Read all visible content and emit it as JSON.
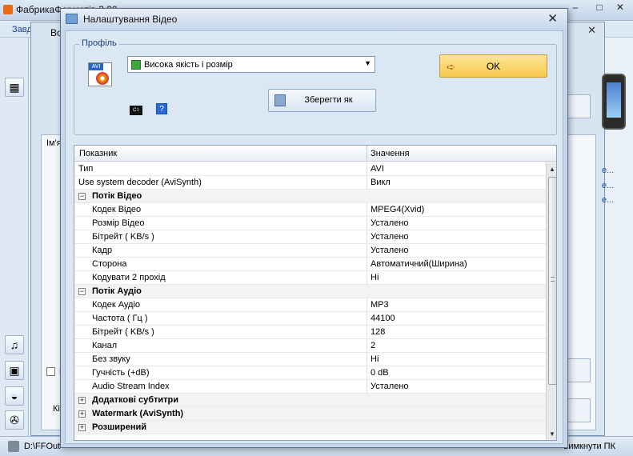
{
  "background": {
    "app_title": "ФабрикаФорматів 3.00",
    "menu_first": "Завд",
    "window2_title": "Во",
    "column_fragment": "Ім'я",
    "links": [
      "е...",
      "е...",
      "е..."
    ],
    "checkbox_fragment": "П",
    "label_fragment": "Кін",
    "status_path": "D:\\FFOut",
    "status_right": "вимкнути ПК"
  },
  "dialog": {
    "title": "Налаштування Відео",
    "profile_group_label": "Профіль",
    "profile_selected": "Висока якість і розмір",
    "ok_label": "OK",
    "save_as_label": "Зберегти як",
    "cmd_icon_text": "C:\\",
    "help_icon_text": "?"
  },
  "grid": {
    "header_name": "Показник",
    "header_value": "Значення",
    "rows": [
      {
        "name": "Тип",
        "value": "AVI"
      },
      {
        "name": "Use system decoder (AviSynth)",
        "value": "Викл"
      },
      {
        "name": "Потік Відео",
        "category": true
      },
      {
        "name": "Кодек Відео",
        "value": "MPEG4(Xvid)"
      },
      {
        "name": "Розмір Відео",
        "value": "Усталено"
      },
      {
        "name": "Бітрейт ( KB/s )",
        "value": "Усталено"
      },
      {
        "name": "Кадр",
        "value": "Усталено"
      },
      {
        "name": "Сторона",
        "value": "Автоматичний(Ширина)"
      },
      {
        "name": "Кодувати 2 прохід",
        "value": "Ні"
      },
      {
        "name": "Потік Аудіо",
        "category": true
      },
      {
        "name": "Кодек Аудіо",
        "value": "MP3"
      },
      {
        "name": "Частота ( Гц )",
        "value": "44100"
      },
      {
        "name": "Бітрейт ( KB/s )",
        "value": "128"
      },
      {
        "name": "Канал",
        "value": "2"
      },
      {
        "name": "Без звуку",
        "value": "Ні"
      },
      {
        "name": "Гучність (+dB)",
        "value": "0 dB"
      },
      {
        "name": "Audio Stream Index",
        "value": "Усталено"
      },
      {
        "name": "Додаткові субтитри",
        "category": true,
        "collapsed": true
      },
      {
        "name": "Watermark (AviSynth)",
        "category": true,
        "collapsed": true
      },
      {
        "name": "Розширений",
        "category": true,
        "collapsed": true
      }
    ]
  },
  "colors": {
    "dialog_bg": "#dce7f4",
    "ok_button": "#f8c84b",
    "accent": "#1d3f7a"
  }
}
